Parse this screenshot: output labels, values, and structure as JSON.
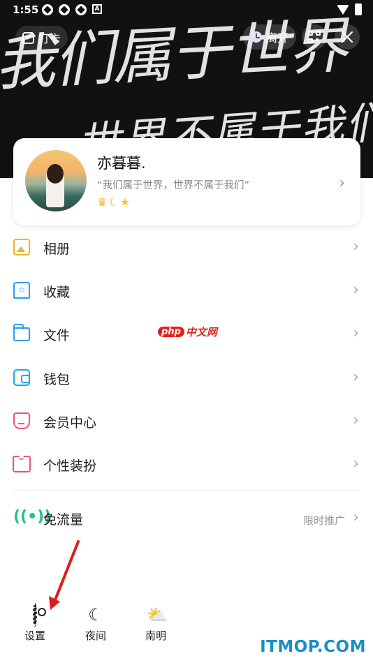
{
  "status_bar": {
    "time": "1:55",
    "notification_icon_names": [
      "app-icon",
      "app-icon",
      "app-icon",
      "a-letter-icon"
    ],
    "right_icon_names": [
      "wifi-icon",
      "battery-icon"
    ]
  },
  "header": {
    "background_handwriting_line1": "我们属于世界",
    "background_handwriting_line2": "世界不属于我们",
    "checkin_label": "打卡",
    "away_label": "离开",
    "qr_icon": "qr-code-icon",
    "close_icon": "close-icon"
  },
  "profile": {
    "nickname": "亦暮暮.",
    "signature": "“我们属于世界，世界不属于我们”",
    "badges": [
      "crown-icon",
      "moon-icon",
      "star-icon"
    ]
  },
  "menu": [
    {
      "label": "相册",
      "icon": "album-icon",
      "color": "#f3b51c"
    },
    {
      "label": "收藏",
      "icon": "favorites-icon",
      "color": "#2b9cf0"
    },
    {
      "label": "文件",
      "icon": "folder-icon",
      "color": "#2b9cf0"
    },
    {
      "label": "钱包",
      "icon": "wallet-icon",
      "color": "#17a7e8"
    },
    {
      "label": "会员中心",
      "icon": "vip-icon",
      "color": "#ef5473"
    },
    {
      "label": "个性装扮",
      "icon": "dress-up-icon",
      "color": "#ef5473"
    }
  ],
  "free_data": {
    "label": "免流量",
    "extra": "限时推广",
    "icon": "signal-icon",
    "color": "#24c17c"
  },
  "bottom": {
    "settings_label": "设置",
    "night_label": "夜间",
    "weather_label": "南明"
  },
  "watermarks": {
    "php_badge": "php",
    "php_text": "中文网",
    "site": "ITMOP.COM"
  },
  "annotation_color": "#e21b1b"
}
